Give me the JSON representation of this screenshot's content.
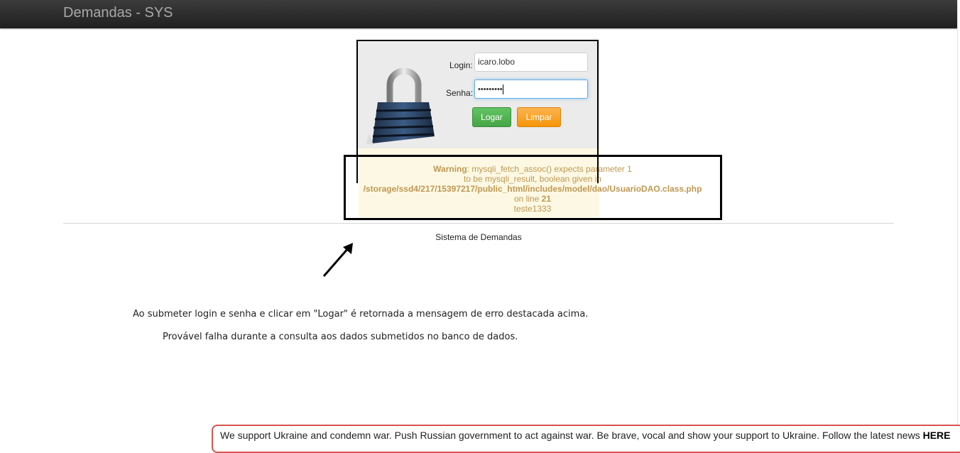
{
  "navbar": {
    "brand": "Demandas - SYS"
  },
  "login_form": {
    "login_label": "Login:",
    "login_value": "icaro.lobo",
    "password_label": "Senha:",
    "password_masked": "•••••••••",
    "submit_label": "Logar",
    "clear_label": "Limpar"
  },
  "warning": {
    "prefix": "Warning",
    "line1": ": mysqli_fetch_assoc() expects parameter 1",
    "line2": "to be mysqli_result, boolean given in",
    "path": "/storage/ssd4/217/15397217/public_html/includes/model/dao/UsuarioDAO.class.php",
    "on_line": "on line ",
    "line_number": "21",
    "extra": "teste1333"
  },
  "footer": {
    "text": "Sistema de Demandas"
  },
  "notes": {
    "line1": "Ao submeter login e senha e clicar em \"Logar\" é retornada a mensagem de erro destacada acima.",
    "line2": "Provável falha durante a consulta aos dados submetidos no banco de dados."
  },
  "banner": {
    "text": "We support Ukraine and condemn war. Push Russian government to act against war. Be brave, vocal and show your support to Ukraine. Follow the latest news ",
    "link": "HERE"
  },
  "colors": {
    "navbar": "#222222",
    "warning_bg": "#fcf8e3",
    "warning_text": "#c09853",
    "btn_green": "#46a546",
    "btn_orange": "#f89406",
    "banner_border": "#d9534f"
  }
}
